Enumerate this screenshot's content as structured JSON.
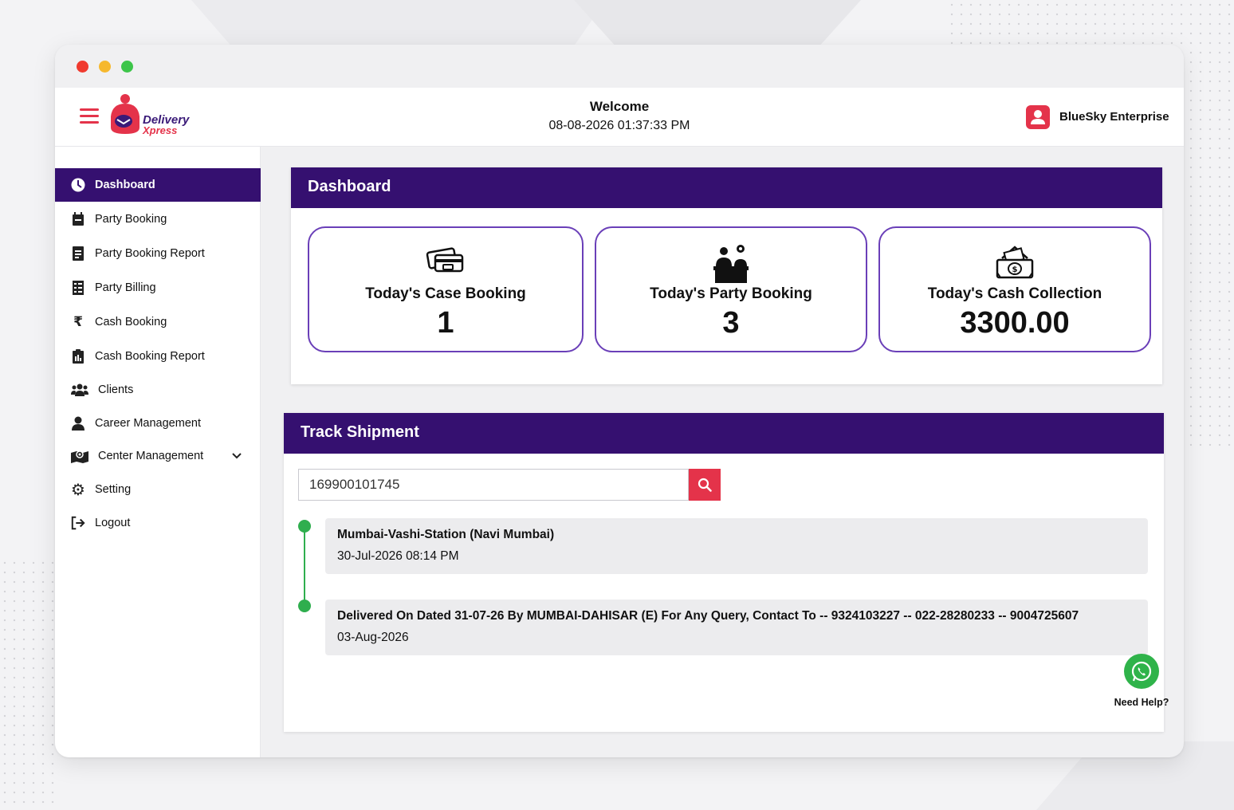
{
  "header": {
    "brand_line1": "Delivery",
    "brand_line2": "Xpress",
    "welcome": "Welcome",
    "datetime": "08-08-2026 01:37:33 PM",
    "user_name": "BlueSky Enterprise"
  },
  "sidebar": {
    "items": [
      {
        "label": "Dashboard",
        "icon": "dashboard-icon"
      },
      {
        "label": "Party Booking",
        "icon": "calendar-icon"
      },
      {
        "label": "Party Booking Report",
        "icon": "report-icon"
      },
      {
        "label": "Party Billing",
        "icon": "billing-icon"
      },
      {
        "label": "Cash Booking",
        "icon": "rupee-icon"
      },
      {
        "label": "Cash Booking Report",
        "icon": "clipboard-icon"
      },
      {
        "label": "Clients",
        "icon": "users-icon"
      },
      {
        "label": "Career Management",
        "icon": "user-icon"
      },
      {
        "label": "Center Management",
        "icon": "map-icon"
      },
      {
        "label": "Setting",
        "icon": "gear-icon"
      },
      {
        "label": "Logout",
        "icon": "logout-icon"
      }
    ]
  },
  "dashboard": {
    "title": "Dashboard",
    "stats": [
      {
        "label": "Today's Case Booking",
        "value": "1",
        "icon": "cards-icon"
      },
      {
        "label": "Today's Party Booking",
        "value": "3",
        "icon": "people-desk-icon"
      },
      {
        "label": "Today's Cash Collection",
        "value": "3300.00",
        "icon": "cash-icon"
      }
    ]
  },
  "track": {
    "title": "Track Shipment",
    "input_value": "169900101745",
    "events": [
      {
        "title": "Mumbai-Vashi-Station (Navi Mumbai)",
        "date": "30-Jul-2026 08:14 PM"
      },
      {
        "title": "Delivered On Dated 31-07-26 By MUMBAI-DAHISAR (E) For Any Query, Contact To -- 9324103227 -- 022-28280233 -- 9004725607",
        "date": "03-Aug-2026"
      }
    ]
  },
  "help": {
    "label": "Need Help?"
  },
  "colors": {
    "primary": "#351070",
    "accent": "#e4334a",
    "success": "#2fae4e",
    "card_border": "#6a3fb8"
  }
}
